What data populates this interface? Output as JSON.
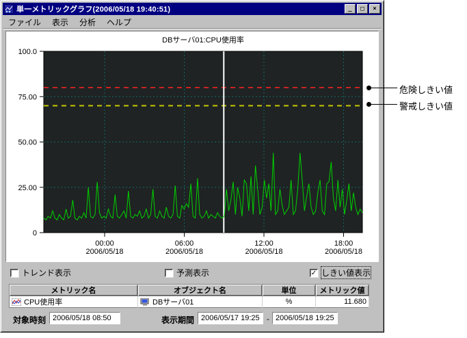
{
  "window": {
    "title": "単一メトリックグラフ(2006/05/18 19:40:51)",
    "controls": {
      "minimize": "_",
      "maximize": "□",
      "close": "×"
    }
  },
  "menu": {
    "items": [
      {
        "label": "ファイル"
      },
      {
        "label": "表示"
      },
      {
        "label": "分析"
      },
      {
        "label": "ヘルプ"
      }
    ]
  },
  "chart_data": {
    "type": "line",
    "title": "DBサーバ01:CPU使用率",
    "xlabel": "",
    "ylabel": "",
    "ylim": [
      0,
      100
    ],
    "grid": true,
    "plot_bg": "#1f2323",
    "grid_color": "#156868",
    "y_ticks": [
      {
        "label": "100.0",
        "value": 100
      },
      {
        "label": "75.00",
        "value": 75
      },
      {
        "label": "50.00",
        "value": 50
      },
      {
        "label": "25.00",
        "value": 25
      },
      {
        "label": "0",
        "value": 0
      }
    ],
    "x_ticks": [
      {
        "time": "00:00",
        "date": "2006/05/18",
        "fraction": 0.191
      },
      {
        "time": "06:00",
        "date": "2006/05/18",
        "fraction": 0.441
      },
      {
        "time": "12:00",
        "date": "2006/05/18",
        "fraction": 0.691
      },
      {
        "time": "18:00",
        "date": "2006/05/18",
        "fraction": 0.941
      }
    ],
    "x_range": [
      "2006/05/17 19:25",
      "2006/05/18 19:25"
    ],
    "thresholds": [
      {
        "name": "危険しきい値",
        "value": 80,
        "color": "#cc2222"
      },
      {
        "name": "警戒しきい値",
        "value": 70,
        "color": "#c8c800"
      }
    ],
    "time_marker": {
      "time": "2006/05/18 08:50",
      "fraction": 0.565,
      "color": "#ffffff"
    },
    "series": [
      {
        "name": "CPU使用率",
        "color": "#00d200",
        "values": [
          8,
          7,
          9,
          8,
          12,
          8,
          7,
          10,
          8,
          7,
          13,
          8,
          9,
          18,
          8,
          7,
          9,
          8,
          11,
          8,
          25,
          9,
          8,
          10,
          28,
          11,
          8,
          9,
          8,
          13,
          9,
          8,
          21,
          9,
          8,
          10,
          12,
          8,
          23,
          9,
          8,
          10,
          9,
          12,
          8,
          9,
          13,
          8,
          10,
          24,
          9,
          8,
          12,
          9,
          8,
          14,
          9,
          8,
          10,
          26,
          9,
          8,
          15,
          13,
          16,
          14,
          27,
          9,
          8,
          30,
          10,
          8,
          9,
          12,
          8,
          10,
          9,
          8,
          11,
          9,
          8,
          9,
          24,
          12,
          18,
          28,
          10,
          25,
          19,
          9,
          29,
          27,
          12,
          31,
          10,
          37,
          24,
          10,
          14,
          29,
          19,
          27,
          12,
          44,
          10,
          12,
          24,
          15,
          10,
          12,
          14,
          29,
          10,
          12,
          24,
          44,
          29,
          12,
          20,
          27,
          14,
          10,
          12,
          22,
          29,
          12,
          10,
          27,
          28,
          39,
          19,
          12,
          29,
          14,
          24,
          10,
          18,
          27,
          12,
          22,
          14,
          10,
          13,
          11
        ]
      }
    ]
  },
  "options": {
    "trend": {
      "label": "トレンド表示",
      "checked": false
    },
    "forecast": {
      "label": "予測表示",
      "checked": false
    },
    "threshold": {
      "label": "しきい値表示",
      "checked": true
    }
  },
  "table": {
    "headers": [
      "メトリック名",
      "オブジェクト名",
      "単位",
      "メトリック値"
    ],
    "rows": [
      {
        "metric": "CPU使用率",
        "object": "DBサーバ01",
        "unit": "%",
        "value": "11.680"
      }
    ]
  },
  "footer": {
    "target_time_label": "対象時刻",
    "target_time": "2006/05/18 08:50",
    "period_label": "表示期間",
    "period_start": "2006/05/17 19:25",
    "period_separator": "-",
    "period_end": "2006/05/18 19:25"
  },
  "annotations": {
    "danger_label": "危険しきい値",
    "warning_label": "警戒しきい値"
  },
  "colors": {
    "titlebar": "#000080",
    "window_bg": "#c0c0c0",
    "danger": "#cc2222",
    "warning": "#c8c800",
    "series": "#00d200"
  }
}
